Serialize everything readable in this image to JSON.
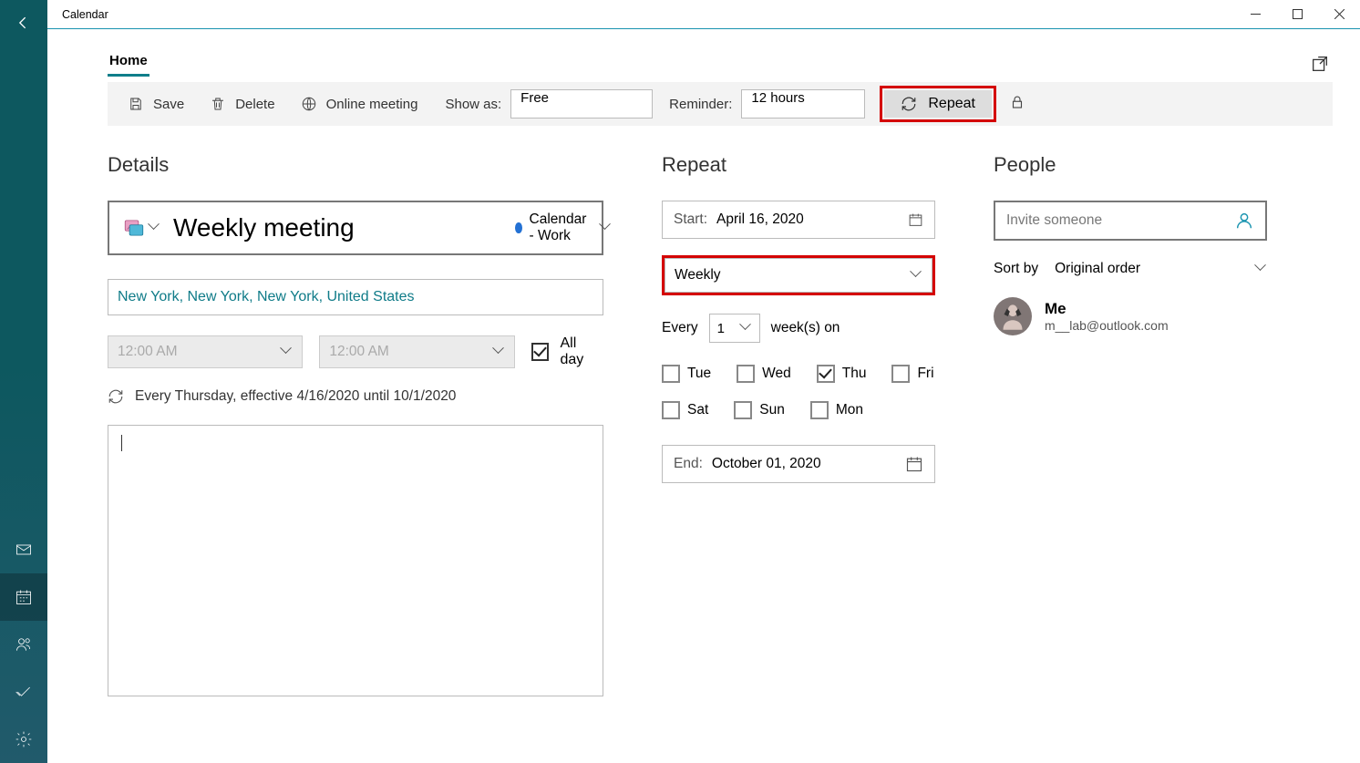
{
  "app_title": "Calendar",
  "tabs": {
    "home": "Home"
  },
  "toolbar": {
    "save": "Save",
    "delete": "Delete",
    "online_meeting": "Online meeting",
    "show_as_label": "Show as:",
    "show_as_value": "Free",
    "reminder_label": "Reminder:",
    "reminder_value": "12 hours",
    "repeat": "Repeat"
  },
  "details": {
    "heading": "Details",
    "title_value": "Weekly meeting",
    "calendar_label": "Calendar - Work",
    "location": "New York, New York, New York, United States",
    "start_time": "12:00 AM",
    "end_time": "12:00 AM",
    "all_day": "All day",
    "recurrence_text": "Every Thursday, effective 4/16/2020 until 10/1/2020"
  },
  "repeat": {
    "heading": "Repeat",
    "start_label": "Start:",
    "start_value": "April 16, 2020",
    "frequency": "Weekly",
    "every_label_pre": "Every",
    "every_value": "1",
    "every_label_post": "week(s) on",
    "days": {
      "tue": "Tue",
      "wed": "Wed",
      "thu": "Thu",
      "fri": "Fri",
      "sat": "Sat",
      "sun": "Sun",
      "mon": "Mon"
    },
    "days_checked": {
      "tue": false,
      "wed": false,
      "thu": true,
      "fri": false,
      "sat": false,
      "sun": false,
      "mon": false
    },
    "end_label": "End:",
    "end_value": "October 01, 2020"
  },
  "people": {
    "heading": "People",
    "invite_placeholder": "Invite someone",
    "sort_label": "Sort by",
    "sort_value": "Original order",
    "me": {
      "name": "Me",
      "email": "m__lab@outlook.com"
    }
  }
}
